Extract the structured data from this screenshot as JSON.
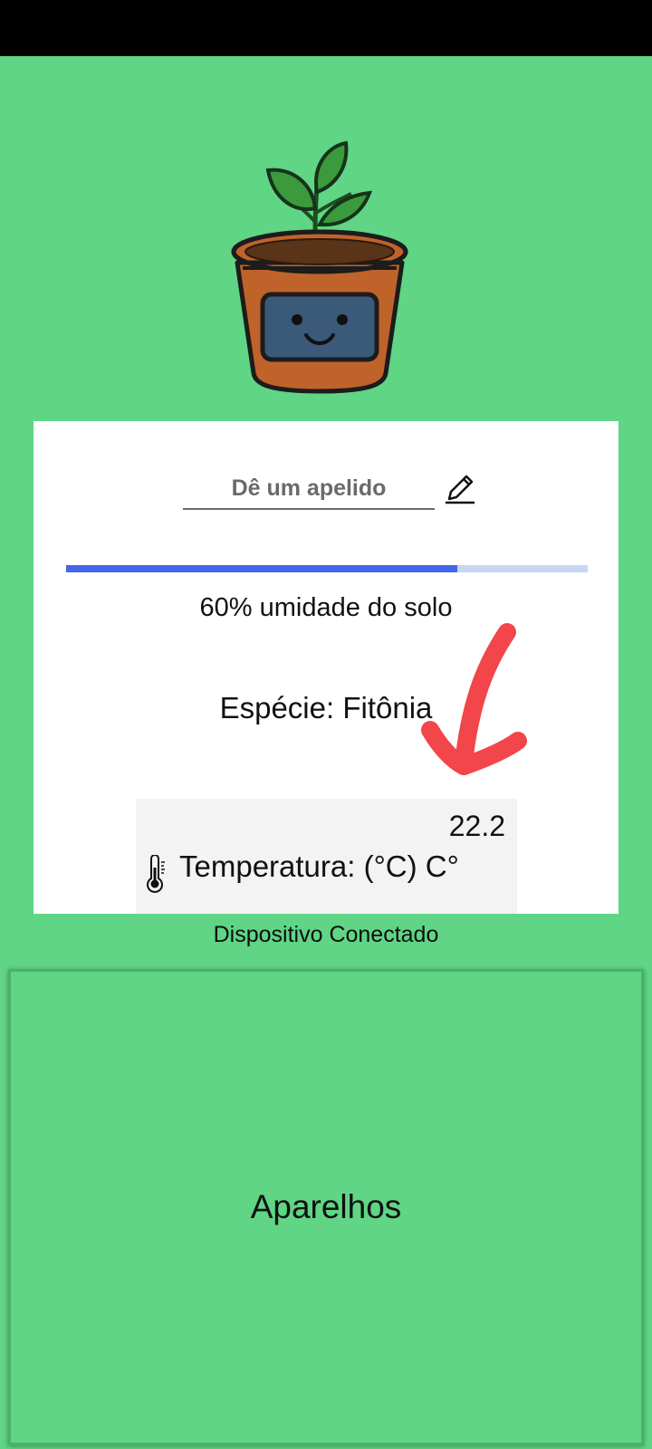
{
  "header": {
    "plant_icon": "smiling-smart-plant-pot-icon"
  },
  "card": {
    "nickname_placeholder": "Dê um apelido",
    "nickname_value": "",
    "edit_icon": "pencil-icon",
    "soil_moisture_percent": 60,
    "moisture_text": "60% umidade do solo",
    "species_text": "Espécie: Fitônia",
    "temperature": {
      "value": "22.2",
      "label": "Temperatura: (°C) C°",
      "icon": "thermometer-icon"
    }
  },
  "annotation": {
    "arrow_icon": "red-arrow-annotation",
    "color": "#f2464b"
  },
  "footer": {
    "connection_status": "Dispositivo Conectado",
    "devices_button": "Aparelhos"
  },
  "colors": {
    "background": "#5fd585",
    "progress_fill": "#4466e8",
    "progress_track": "#c8d6f5",
    "pot": "#c0632a",
    "screen": "#3b5a7a",
    "leaf": "#3b9a3b"
  }
}
